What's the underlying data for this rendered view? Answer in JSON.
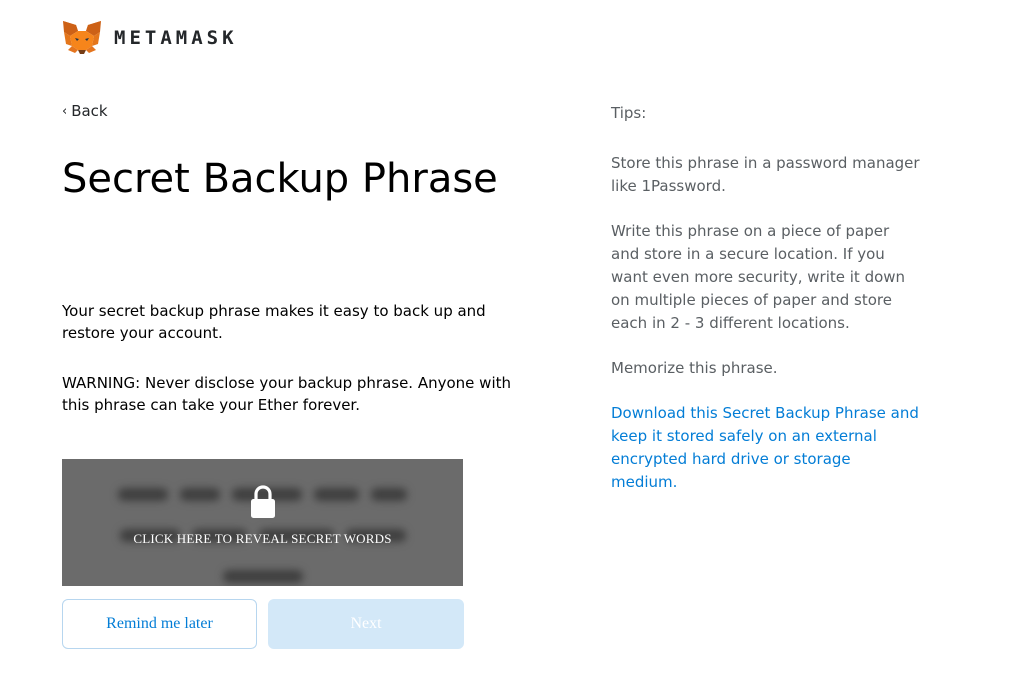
{
  "brand": {
    "name": "METAMASK",
    "logo_icon": "metamask-fox-icon",
    "logo_colors": [
      "#e2761b",
      "#cd6116",
      "#f6851b",
      "#763d16",
      "#233447",
      "#e4761b"
    ]
  },
  "nav": {
    "back_label": "Back",
    "back_icon": "chevron-left-icon"
  },
  "main": {
    "title": "Secret Backup Phrase",
    "intro": "Your secret backup phrase makes it easy to back up and restore your account.",
    "warning": "WARNING: Never disclose your backup phrase. Anyone with this phrase can take your Ether forever.",
    "reveal": {
      "label": "CLICK HERE TO REVEAL SECRET WORDS",
      "icon": "lock-icon",
      "background": "#6b6b6b"
    }
  },
  "actions": {
    "remind_label": "Remind me later",
    "next_label": "Next",
    "next_disabled": true
  },
  "tips": {
    "heading": "Tips:",
    "items": [
      "Store this phrase in a password manager like 1Password.",
      "Write this phrase on a piece of paper and store in a secure location. If you want even more security, write it down on multiple pieces of paper and store each in 2 - 3 different locations.",
      "Memorize this phrase."
    ],
    "download_link": "Download this Secret Backup Phrase and keep it stored safely on an external encrypted hard drive or storage medium."
  },
  "colors": {
    "accent": "#037dd6",
    "disabled_button": "#d3e8f8",
    "text_dark": "#000000",
    "text_muted": "#5a5f63"
  }
}
